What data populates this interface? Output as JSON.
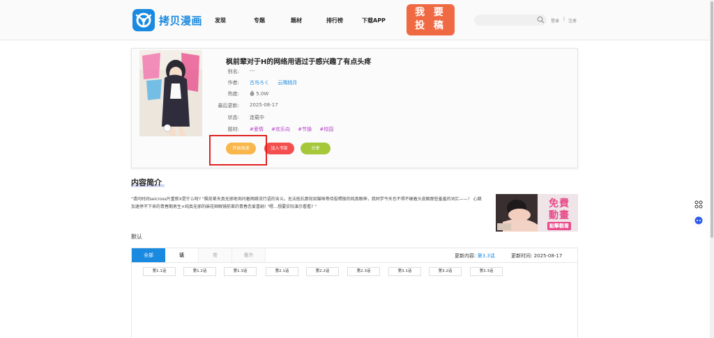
{
  "header": {
    "logo_text": "拷贝漫画",
    "nav": [
      "发现",
      "专题",
      "题材",
      "排行榜",
      "下载APP"
    ],
    "submit_line1": "我 要",
    "submit_line2": "投 稿",
    "search_placeholder": "",
    "login": "登录",
    "separator": "|",
    "register": "注册"
  },
  "comic": {
    "title": "枫前辈对于H的网络用语过于感兴趣了有点头疼",
    "rows": [
      {
        "label": "别名:",
        "value": "---"
      },
      {
        "label": "作者:",
        "author1": "古鸟ろく",
        "author2": "云隅桃月"
      },
      {
        "label": "热度:",
        "value": "5.0W"
      },
      {
        "label": "最后更新:",
        "value": "2025-08-17"
      },
      {
        "label": "状态:",
        "value": "连载中"
      },
      {
        "label": "题材:",
        "tags": [
          "#爱情",
          "#欢乐向",
          "#节操",
          "#校园"
        ]
      }
    ],
    "buttons": {
      "read": "开始阅读",
      "shelf": "加入书架",
      "share": "分享"
    }
  },
  "intro": {
    "title": "内容简介",
    "text": "\"请问时间seicross片重新X是什么呀? \"枫前辈天真无邪地询问着网络流行语的含义。无法抵抗那宛如猫咪等待投喂般的纯真眼神，我同学今天也不得不硬着头皮解那些羞羞的词汇——！ 心跳加速停不下来的青春期男生×纯真无邪的麻花辫眼镜前辈的青春恋爱喜剧! \"嗯…想要实际演示看看? \""
  },
  "ad": {
    "line1": "免費",
    "line2": "動畫",
    "line3": "點擊觀看"
  },
  "chapters": {
    "group_label": "默认",
    "tabs": [
      "全部",
      "话",
      "卷",
      "番外"
    ],
    "update_label": "更新内容:",
    "update_value": "第3.3话",
    "time_label": "更新时间:",
    "time_value": "2025-08-17",
    "list": [
      "第1.1话",
      "第1.2话",
      "第1.3话",
      "第2.1话",
      "第2.2话",
      "第2.3话",
      "第3.1话",
      "第3.2话",
      "第3.3话"
    ]
  },
  "colors": {
    "brand": "#1a8ae0",
    "submit": "#ef6a43",
    "read": "#f9b64b",
    "shelf": "#f54e4e",
    "share": "#a5c83b",
    "tag": "#b43bc7"
  }
}
